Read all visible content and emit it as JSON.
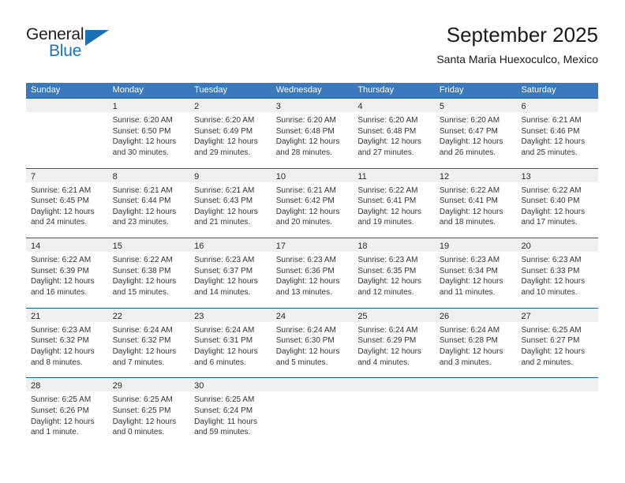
{
  "brand": {
    "word_general": "General",
    "word_blue": "Blue",
    "accent_color": "#1a6fb5"
  },
  "header": {
    "title": "September 2025",
    "subtitle": "Santa Maria Huexoculco, Mexico",
    "header_bg": "#3a79bd",
    "separator_color": "#1c5ea0",
    "daynum_band_color": "#f0f0f0"
  },
  "weekdays": [
    "Sunday",
    "Monday",
    "Tuesday",
    "Wednesday",
    "Thursday",
    "Friday",
    "Saturday"
  ],
  "weeks": [
    [
      {
        "day": "",
        "empty": true,
        "l1": "",
        "l2": "",
        "l3": "",
        "l4": ""
      },
      {
        "day": "1",
        "l1": "Sunrise: 6:20 AM",
        "l2": "Sunset: 6:50 PM",
        "l3": "Daylight: 12 hours",
        "l4": "and 30 minutes."
      },
      {
        "day": "2",
        "l1": "Sunrise: 6:20 AM",
        "l2": "Sunset: 6:49 PM",
        "l3": "Daylight: 12 hours",
        "l4": "and 29 minutes."
      },
      {
        "day": "3",
        "l1": "Sunrise: 6:20 AM",
        "l2": "Sunset: 6:48 PM",
        "l3": "Daylight: 12 hours",
        "l4": "and 28 minutes."
      },
      {
        "day": "4",
        "l1": "Sunrise: 6:20 AM",
        "l2": "Sunset: 6:48 PM",
        "l3": "Daylight: 12 hours",
        "l4": "and 27 minutes."
      },
      {
        "day": "5",
        "l1": "Sunrise: 6:20 AM",
        "l2": "Sunset: 6:47 PM",
        "l3": "Daylight: 12 hours",
        "l4": "and 26 minutes."
      },
      {
        "day": "6",
        "l1": "Sunrise: 6:21 AM",
        "l2": "Sunset: 6:46 PM",
        "l3": "Daylight: 12 hours",
        "l4": "and 25 minutes."
      }
    ],
    [
      {
        "day": "7",
        "l1": "Sunrise: 6:21 AM",
        "l2": "Sunset: 6:45 PM",
        "l3": "Daylight: 12 hours",
        "l4": "and 24 minutes."
      },
      {
        "day": "8",
        "l1": "Sunrise: 6:21 AM",
        "l2": "Sunset: 6:44 PM",
        "l3": "Daylight: 12 hours",
        "l4": "and 23 minutes."
      },
      {
        "day": "9",
        "l1": "Sunrise: 6:21 AM",
        "l2": "Sunset: 6:43 PM",
        "l3": "Daylight: 12 hours",
        "l4": "and 21 minutes."
      },
      {
        "day": "10",
        "l1": "Sunrise: 6:21 AM",
        "l2": "Sunset: 6:42 PM",
        "l3": "Daylight: 12 hours",
        "l4": "and 20 minutes."
      },
      {
        "day": "11",
        "l1": "Sunrise: 6:22 AM",
        "l2": "Sunset: 6:41 PM",
        "l3": "Daylight: 12 hours",
        "l4": "and 19 minutes."
      },
      {
        "day": "12",
        "l1": "Sunrise: 6:22 AM",
        "l2": "Sunset: 6:41 PM",
        "l3": "Daylight: 12 hours",
        "l4": "and 18 minutes."
      },
      {
        "day": "13",
        "l1": "Sunrise: 6:22 AM",
        "l2": "Sunset: 6:40 PM",
        "l3": "Daylight: 12 hours",
        "l4": "and 17 minutes."
      }
    ],
    [
      {
        "day": "14",
        "l1": "Sunrise: 6:22 AM",
        "l2": "Sunset: 6:39 PM",
        "l3": "Daylight: 12 hours",
        "l4": "and 16 minutes."
      },
      {
        "day": "15",
        "l1": "Sunrise: 6:22 AM",
        "l2": "Sunset: 6:38 PM",
        "l3": "Daylight: 12 hours",
        "l4": "and 15 minutes."
      },
      {
        "day": "16",
        "l1": "Sunrise: 6:23 AM",
        "l2": "Sunset: 6:37 PM",
        "l3": "Daylight: 12 hours",
        "l4": "and 14 minutes."
      },
      {
        "day": "17",
        "l1": "Sunrise: 6:23 AM",
        "l2": "Sunset: 6:36 PM",
        "l3": "Daylight: 12 hours",
        "l4": "and 13 minutes."
      },
      {
        "day": "18",
        "l1": "Sunrise: 6:23 AM",
        "l2": "Sunset: 6:35 PM",
        "l3": "Daylight: 12 hours",
        "l4": "and 12 minutes."
      },
      {
        "day": "19",
        "l1": "Sunrise: 6:23 AM",
        "l2": "Sunset: 6:34 PM",
        "l3": "Daylight: 12 hours",
        "l4": "and 11 minutes."
      },
      {
        "day": "20",
        "l1": "Sunrise: 6:23 AM",
        "l2": "Sunset: 6:33 PM",
        "l3": "Daylight: 12 hours",
        "l4": "and 10 minutes."
      }
    ],
    [
      {
        "day": "21",
        "l1": "Sunrise: 6:23 AM",
        "l2": "Sunset: 6:32 PM",
        "l3": "Daylight: 12 hours",
        "l4": "and 8 minutes."
      },
      {
        "day": "22",
        "l1": "Sunrise: 6:24 AM",
        "l2": "Sunset: 6:32 PM",
        "l3": "Daylight: 12 hours",
        "l4": "and 7 minutes."
      },
      {
        "day": "23",
        "l1": "Sunrise: 6:24 AM",
        "l2": "Sunset: 6:31 PM",
        "l3": "Daylight: 12 hours",
        "l4": "and 6 minutes."
      },
      {
        "day": "24",
        "l1": "Sunrise: 6:24 AM",
        "l2": "Sunset: 6:30 PM",
        "l3": "Daylight: 12 hours",
        "l4": "and 5 minutes."
      },
      {
        "day": "25",
        "l1": "Sunrise: 6:24 AM",
        "l2": "Sunset: 6:29 PM",
        "l3": "Daylight: 12 hours",
        "l4": "and 4 minutes."
      },
      {
        "day": "26",
        "l1": "Sunrise: 6:24 AM",
        "l2": "Sunset: 6:28 PM",
        "l3": "Daylight: 12 hours",
        "l4": "and 3 minutes."
      },
      {
        "day": "27",
        "l1": "Sunrise: 6:25 AM",
        "l2": "Sunset: 6:27 PM",
        "l3": "Daylight: 12 hours",
        "l4": "and 2 minutes."
      }
    ],
    [
      {
        "day": "28",
        "l1": "Sunrise: 6:25 AM",
        "l2": "Sunset: 6:26 PM",
        "l3": "Daylight: 12 hours",
        "l4": "and 1 minute."
      },
      {
        "day": "29",
        "l1": "Sunrise: 6:25 AM",
        "l2": "Sunset: 6:25 PM",
        "l3": "Daylight: 12 hours",
        "l4": "and 0 minutes."
      },
      {
        "day": "30",
        "l1": "Sunrise: 6:25 AM",
        "l2": "Sunset: 6:24 PM",
        "l3": "Daylight: 11 hours",
        "l4": "and 59 minutes."
      },
      {
        "day": "",
        "empty": true,
        "l1": "",
        "l2": "",
        "l3": "",
        "l4": ""
      },
      {
        "day": "",
        "empty": true,
        "l1": "",
        "l2": "",
        "l3": "",
        "l4": ""
      },
      {
        "day": "",
        "empty": true,
        "l1": "",
        "l2": "",
        "l3": "",
        "l4": ""
      },
      {
        "day": "",
        "empty": true,
        "l1": "",
        "l2": "",
        "l3": "",
        "l4": ""
      }
    ]
  ]
}
